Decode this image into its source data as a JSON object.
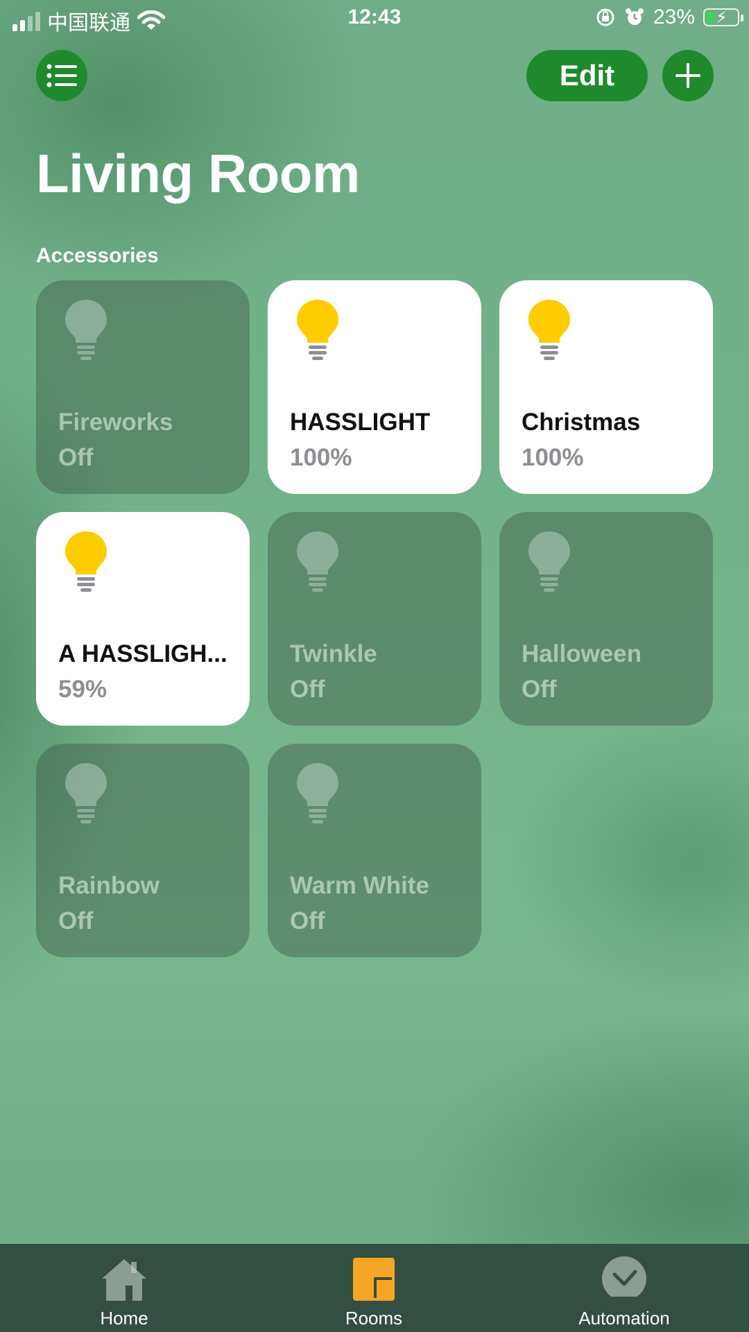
{
  "status_bar": {
    "carrier": "中国联通",
    "time": "12:43",
    "battery": "23%",
    "battery_level": 0.23,
    "signal_bars": 2
  },
  "header": {
    "edit_label": "Edit",
    "title": "Living Room"
  },
  "section": {
    "label": "Accessories"
  },
  "accessories": [
    {
      "name": "Fireworks",
      "state": "Off",
      "on": false
    },
    {
      "name": "HASSLIGHT",
      "state": "100%",
      "on": true
    },
    {
      "name": "Christmas",
      "state": "100%",
      "on": true
    },
    {
      "name": "A HASSLIGH...",
      "state": "59%",
      "on": true
    },
    {
      "name": "Twinkle",
      "state": "Off",
      "on": false
    },
    {
      "name": "Halloween",
      "state": "Off",
      "on": false
    },
    {
      "name": "Rainbow",
      "state": "Off",
      "on": false
    },
    {
      "name": "Warm White",
      "state": "Off",
      "on": false
    }
  ],
  "tabbar": {
    "tabs": [
      {
        "label": "Home",
        "icon": "house-icon",
        "active": false
      },
      {
        "label": "Rooms",
        "icon": "rooms-icon",
        "active": true
      },
      {
        "label": "Automation",
        "icon": "clock-check-icon",
        "active": false
      }
    ]
  },
  "colors": {
    "accent_green": "#1f8a2c",
    "bulb_on": "#ffcc00",
    "tab_active": "#f5a623"
  }
}
